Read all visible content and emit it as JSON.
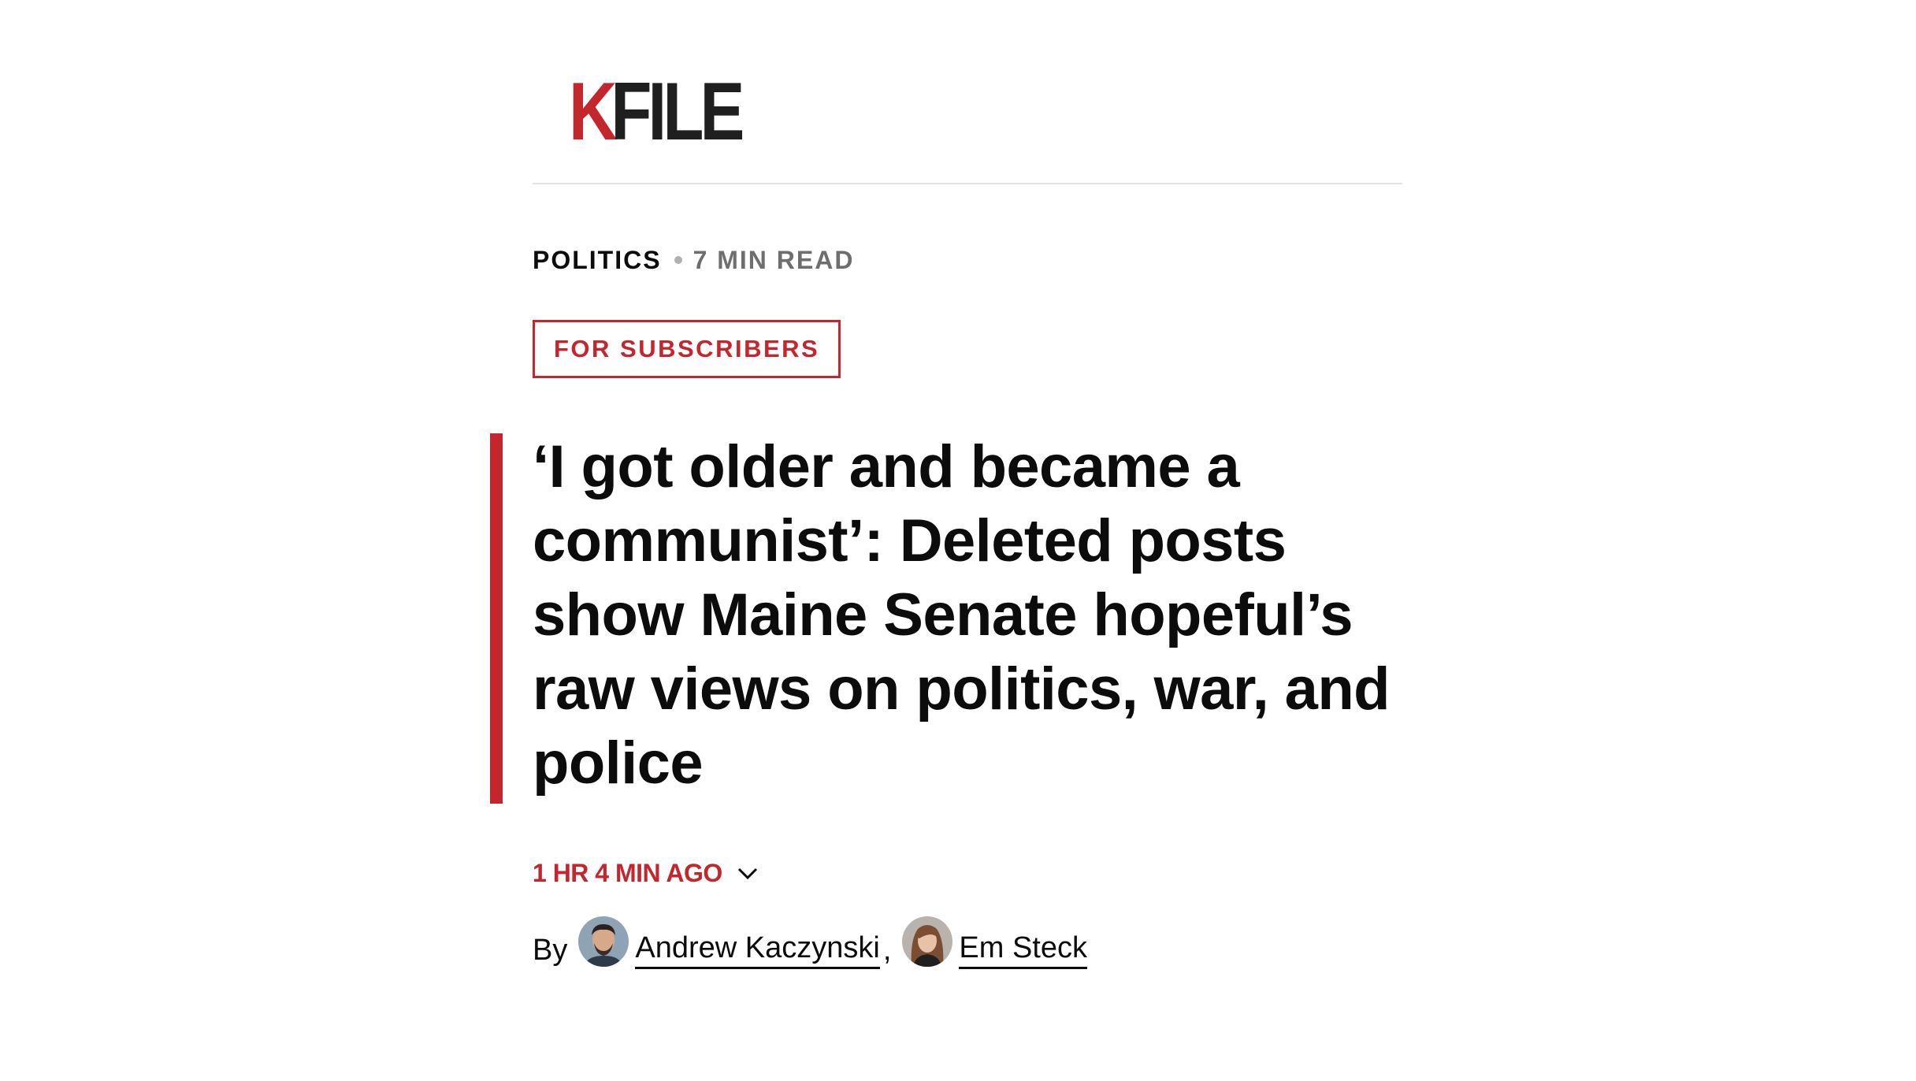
{
  "brand": {
    "logo_k": "K",
    "logo_rest": "FILE"
  },
  "meta": {
    "section": "POLITICS",
    "read_time": "7 MIN READ"
  },
  "badge": {
    "label": "FOR SUBSCRIBERS"
  },
  "headline": "‘I got older and became a communist’: Deleted posts show Maine Senate hopeful’s raw views on politics, war, and police",
  "timestamp": {
    "label": "1 HR 4 MIN AGO"
  },
  "byline": {
    "prefix": "By",
    "separator": ",",
    "authors": [
      {
        "name": "Andrew Kaczynski"
      },
      {
        "name": "Em Steck"
      }
    ]
  },
  "colors": {
    "accent": "#c4262e",
    "text": "#0c0c0c",
    "muted": "#6e6e6e",
    "divider": "#e3e3e3"
  }
}
